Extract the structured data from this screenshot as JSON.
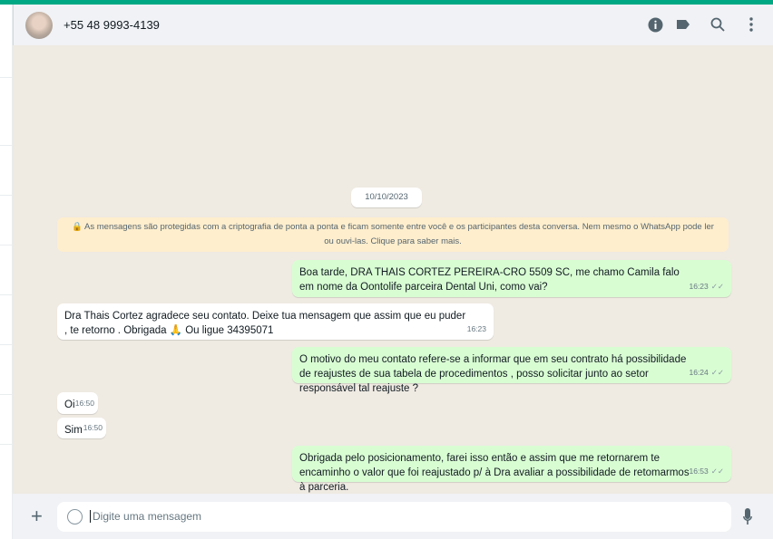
{
  "header": {
    "contact": "+55 48 9993-4139"
  },
  "chat": {
    "date": "10/10/2023",
    "notice": "🔒 As mensagens são protegidas com a criptografia de ponta a ponta e ficam somente entre você e os participantes desta conversa. Nem mesmo o WhatsApp pode ler ou ouvi-las. Clique para saber mais.",
    "messages": [
      {
        "dir": "out",
        "text": "Boa tarde, DRA THAIS CORTEZ PEREIRA-CRO 5509 SC, me chamo Camila  falo em nome da Oontolife parceira Dental Uni, como vai?",
        "time": "16:23"
      },
      {
        "dir": "in",
        "text": "Dra Thais Cortez agradece seu contato. Deixe tua mensagem que assim que eu puder , te retorno . Obrigada 🙏 Ou ligue 34395071",
        "time": "16:23"
      },
      {
        "dir": "out",
        "text": "O motivo do meu contato refere-se a informar que em seu contrato há possibilidade de reajustes de sua tabela de procedimentos , posso solicitar junto ao setor responsável tal reajuste ?",
        "time": "16:24"
      },
      {
        "dir": "in",
        "text": "Oi",
        "time": "16:50"
      },
      {
        "dir": "in",
        "text": "Sim",
        "time": "16:50"
      },
      {
        "dir": "out",
        "text": "Obrigada pelo posicionamento, farei isso então e assim que me retornarem te encaminho o valor que foi reajustado p/ à Dra avaliar a possibilidade de retomarmos à parceria.",
        "time": "16:53"
      }
    ]
  },
  "footer": {
    "placeholder": "Digite uma mensagem"
  },
  "colors": {
    "accent": "#00a884",
    "outgoing": "#d9fdd3",
    "incoming": "#ffffff",
    "background": "#efeae2"
  }
}
